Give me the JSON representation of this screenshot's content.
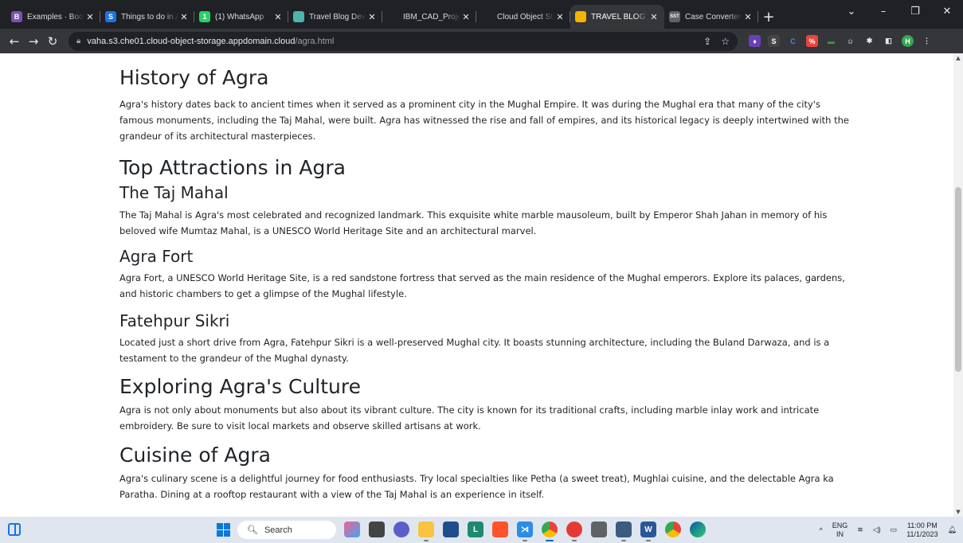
{
  "browser": {
    "tabs": [
      {
        "title": "Examples · Bootstrap",
        "icon": "bootstrap-icon",
        "color": "#7952b3",
        "glyph": "B"
      },
      {
        "title": "Things to do in Agra",
        "icon": "tripadvisor-icon",
        "color": "#1a73e8",
        "glyph": "S"
      },
      {
        "title": "(1) WhatsApp",
        "icon": "whatsapp-icon",
        "color": "#25d366",
        "glyph": "1"
      },
      {
        "title": "Travel Blog Development",
        "icon": "document-icon",
        "color": "#4db6ac",
        "glyph": ""
      },
      {
        "title": "IBM_CAD_Project",
        "icon": "github-icon",
        "color": "#202124",
        "glyph": ""
      },
      {
        "title": "Cloud Object Storage",
        "icon": "cloud-icon",
        "color": "#202124",
        "glyph": ""
      },
      {
        "title": "TRAVEL BLOG",
        "icon": "travel-blog-icon",
        "color": "#f4b400",
        "glyph": "",
        "active": true
      },
      {
        "title": "Case Converter",
        "icon": "case-converter-icon",
        "color": "#5f6368",
        "glyph": "SST"
      }
    ],
    "new_tab": "+",
    "url_host": "vaha.s3.che01.cloud-object-storage.appdomain.cloud",
    "url_path": "/agra.html"
  },
  "article": {
    "history": {
      "heading": "History of Agra",
      "text": "Agra's history dates back to ancient times when it served as a prominent city in the Mughal Empire. It was during the Mughal era that many of the city's famous monuments, including the Taj Mahal, were built. Agra has witnessed the rise and fall of empires, and its historical legacy is deeply intertwined with the grandeur of its architectural masterpieces."
    },
    "attractions": {
      "heading": "Top Attractions in Agra",
      "taj": {
        "heading": "The Taj Mahal",
        "text": "The Taj Mahal is Agra's most celebrated and recognized landmark. This exquisite white marble mausoleum, built by Emperor Shah Jahan in memory of his beloved wife Mumtaz Mahal, is a UNESCO World Heritage Site and an architectural marvel."
      },
      "fort": {
        "heading": "Agra Fort",
        "text": "Agra Fort, a UNESCO World Heritage Site, is a red sandstone fortress that served as the main residence of the Mughal emperors. Explore its palaces, gardens, and historic chambers to get a glimpse of the Mughal lifestyle."
      },
      "fatehpur": {
        "heading": "Fatehpur Sikri",
        "text": "Located just a short drive from Agra, Fatehpur Sikri is a well-preserved Mughal city. It boasts stunning architecture, including the Buland Darwaza, and is a testament to the grandeur of the Mughal dynasty."
      }
    },
    "culture": {
      "heading": "Exploring Agra's Culture",
      "text": "Agra is not only about monuments but also about its vibrant culture. The city is known for its traditional crafts, including marble inlay work and intricate embroidery. Be sure to visit local markets and observe skilled artisans at work."
    },
    "cuisine": {
      "heading": "Cuisine of Agra",
      "text": "Agra's culinary scene is a delightful journey for food enthusiasts. Try local specialties like Petha (a sweet treat), Mughlai cuisine, and the delectable Agra ka Paratha. Dining at a rooftop restaurant with a view of the Taj Mahal is an experience in itself."
    }
  },
  "taskbar": {
    "search_label": "Search",
    "language_top": "ENG",
    "language_bottom": "IN",
    "time": "11:00 PM",
    "date": "11/1/2023"
  }
}
